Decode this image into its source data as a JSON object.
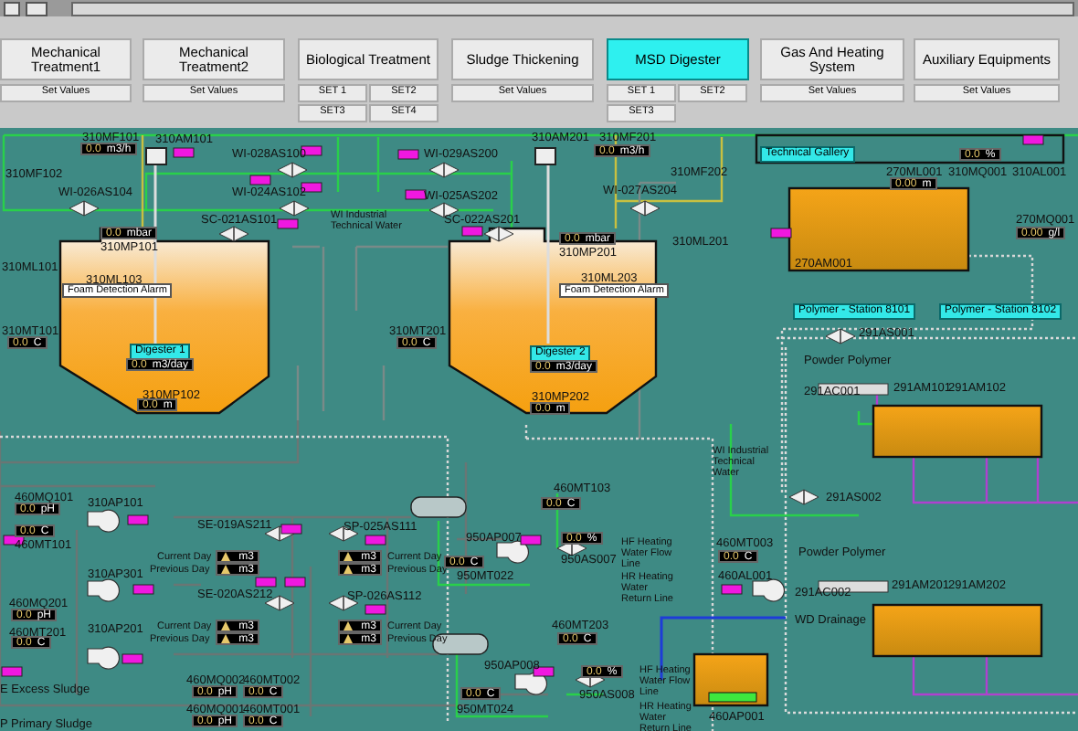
{
  "nav": [
    {
      "label": "Mechanical Treatment1",
      "selected": false,
      "sub": [
        "Set Values"
      ]
    },
    {
      "label": "Mechanical Treatment2",
      "selected": false,
      "sub": [
        "Set Values"
      ]
    },
    {
      "label": "Biological Treatment",
      "selected": false,
      "sub": [
        "SET 1",
        "SET2",
        "SET3",
        "SET4"
      ]
    },
    {
      "label": "Sludge Thickening",
      "selected": false,
      "sub": [
        "Set Values"
      ]
    },
    {
      "label": "MSD Digester",
      "selected": true,
      "sub": [
        "SET 1",
        "SET2",
        "SET3"
      ]
    },
    {
      "label": "Gas And Heating System",
      "selected": false,
      "sub": [
        "Set Values"
      ]
    },
    {
      "label": "Auxiliary Equipments",
      "selected": false,
      "sub": [
        "Set Values"
      ]
    }
  ],
  "diagram": {
    "items": [
      {
        "kind": "tag",
        "text": "310MF101"
      },
      {
        "kind": "readout",
        "value": "0.0",
        "unit": "m3/h"
      },
      {
        "kind": "tag",
        "text": "310AM101"
      },
      {
        "kind": "tag",
        "text": "310MF102"
      },
      {
        "kind": "tag",
        "text": "WI-026AS104"
      },
      {
        "kind": "tag",
        "text": "WI-028AS100"
      },
      {
        "kind": "tag",
        "text": "WI-024AS102"
      },
      {
        "kind": "tag",
        "text": "WI-029AS200"
      },
      {
        "kind": "tag",
        "text": "WI-025AS202"
      },
      {
        "kind": "tag",
        "text": "SC-021AS101"
      },
      {
        "kind": "note",
        "text": "WI Industrial Technical Water"
      },
      {
        "kind": "tag",
        "text": "SC-022AS201"
      },
      {
        "kind": "readout",
        "value": "0.0",
        "unit": "mbar"
      },
      {
        "kind": "tag",
        "text": "310MP101"
      },
      {
        "kind": "tag",
        "text": "310ML101"
      },
      {
        "kind": "tag",
        "text": "310ML103"
      },
      {
        "kind": "alarm",
        "text": "Foam Detection Alarm"
      },
      {
        "kind": "tag",
        "text": "310MT101"
      },
      {
        "kind": "readout",
        "value": "0.0",
        "unit": "C"
      },
      {
        "kind": "label",
        "text": "Digester 1"
      },
      {
        "kind": "readout",
        "value": "0.0",
        "unit": "m3/day"
      },
      {
        "kind": "tag",
        "text": "310MP102"
      },
      {
        "kind": "readout",
        "value": "0.0",
        "unit": "m"
      },
      {
        "kind": "tag",
        "text": "310MT201"
      },
      {
        "kind": "readout",
        "value": "0.0",
        "unit": "C"
      },
      {
        "kind": "tag",
        "text": "310AM201"
      },
      {
        "kind": "tag",
        "text": "310MF201"
      },
      {
        "kind": "readout",
        "value": "0.0",
        "unit": "m3/h"
      },
      {
        "kind": "label",
        "text": "Technical Gallery"
      },
      {
        "kind": "readout",
        "value": "0.0",
        "unit": "%"
      },
      {
        "kind": "tag",
        "text": "310MF202"
      },
      {
        "kind": "tag",
        "text": "270ML001"
      },
      {
        "kind": "tag",
        "text": "310MQ001"
      },
      {
        "kind": "tag",
        "text": "310AL001"
      },
      {
        "kind": "tag",
        "text": "WI-027AS204"
      },
      {
        "kind": "readout",
        "value": "0.00",
        "unit": "m"
      },
      {
        "kind": "readout",
        "value": "0.0",
        "unit": "mbar"
      },
      {
        "kind": "tag",
        "text": "310MP201"
      },
      {
        "kind": "tag",
        "text": "310ML201"
      },
      {
        "kind": "tag",
        "text": "310ML203"
      },
      {
        "kind": "alarm",
        "text": "Foam Detection Alarm"
      },
      {
        "kind": "tag",
        "text": "270AM001"
      },
      {
        "kind": "tag",
        "text": "270MQ001"
      },
      {
        "kind": "readout",
        "value": "0.00",
        "unit": "g/l"
      },
      {
        "kind": "label",
        "text": "Digester 2"
      },
      {
        "kind": "readout",
        "value": "0.0",
        "unit": "m3/day"
      },
      {
        "kind": "tag",
        "text": "310MP202"
      },
      {
        "kind": "readout",
        "value": "0.0",
        "unit": "m"
      },
      {
        "kind": "label",
        "text": "Polymer - Station 8101"
      },
      {
        "kind": "label",
        "text": "Polymer - Station 8102"
      },
      {
        "kind": "tag",
        "text": "291AS001"
      },
      {
        "kind": "tag",
        "text": "Powder Polymer"
      },
      {
        "kind": "tag",
        "text": "291AC001"
      },
      {
        "kind": "tag",
        "text": "291AM101"
      },
      {
        "kind": "tag",
        "text": "291AM102"
      },
      {
        "kind": "tag",
        "text": "460MQ101"
      },
      {
        "kind": "readout",
        "value": "0.0",
        "unit": "pH"
      },
      {
        "kind": "readout",
        "value": "0.0",
        "unit": "C"
      },
      {
        "kind": "tag",
        "text": "460MT101"
      },
      {
        "kind": "tag",
        "text": "310AP101"
      },
      {
        "kind": "tag",
        "text": "310AP301"
      },
      {
        "kind": "tag",
        "text": "310AP201"
      },
      {
        "kind": "tag",
        "text": "460MQ201"
      },
      {
        "kind": "readout",
        "value": "0.0",
        "unit": "pH"
      },
      {
        "kind": "tag",
        "text": "460MT201"
      },
      {
        "kind": "readout",
        "value": "0.0",
        "unit": "C"
      },
      {
        "kind": "tag",
        "text": "SE-019AS211"
      },
      {
        "kind": "note",
        "text": "Current Day"
      },
      {
        "kind": "counter",
        "unit": "m3"
      },
      {
        "kind": "note",
        "text": "Previous Day"
      },
      {
        "kind": "counter",
        "unit": "m3"
      },
      {
        "kind": "tag",
        "text": "SE-020AS212"
      },
      {
        "kind": "note",
        "text": "Current Day"
      },
      {
        "kind": "counter",
        "unit": "m3"
      },
      {
        "kind": "note",
        "text": "Previous Day"
      },
      {
        "kind": "counter",
        "unit": "m3"
      },
      {
        "kind": "tag",
        "text": "SP-025AS111"
      },
      {
        "kind": "counter",
        "unit": "m3"
      },
      {
        "kind": "note",
        "text": "Current Day"
      },
      {
        "kind": "counter",
        "unit": "m3"
      },
      {
        "kind": "note",
        "text": "Previous Day"
      },
      {
        "kind": "tag",
        "text": "SP-026AS112"
      },
      {
        "kind": "counter",
        "unit": "m3"
      },
      {
        "kind": "note",
        "text": "Current Day"
      },
      {
        "kind": "counter",
        "unit": "m3"
      },
      {
        "kind": "note",
        "text": "Previous Day"
      },
      {
        "kind": "tag",
        "text": "950AP007"
      },
      {
        "kind": "readout",
        "value": "0.0",
        "unit": "C"
      },
      {
        "kind": "tag",
        "text": "950MT022"
      },
      {
        "kind": "tag",
        "text": "E Excess Sludge"
      },
      {
        "kind": "tag",
        "text": "P Primary Sludge"
      },
      {
        "kind": "tag",
        "text": "460MQ002"
      },
      {
        "kind": "readout",
        "value": "0.0",
        "unit": "pH"
      },
      {
        "kind": "tag",
        "text": "460MT002"
      },
      {
        "kind": "readout",
        "value": "0.0",
        "unit": "C"
      },
      {
        "kind": "tag",
        "text": "460MQ001"
      },
      {
        "kind": "readout",
        "value": "0.0",
        "unit": "pH"
      },
      {
        "kind": "tag",
        "text": "460MT001"
      },
      {
        "kind": "readout",
        "value": "0.0",
        "unit": "C"
      },
      {
        "kind": "tag",
        "text": "950AP008"
      },
      {
        "kind": "readout",
        "value": "0.0",
        "unit": "C"
      },
      {
        "kind": "tag",
        "text": "950MT024"
      },
      {
        "kind": "note",
        "text": "WI Industrial Technical Water"
      },
      {
        "kind": "tag",
        "text": "460MT103"
      },
      {
        "kind": "readout",
        "value": "0.0",
        "unit": "C"
      },
      {
        "kind": "readout",
        "value": "0.0",
        "unit": "%"
      },
      {
        "kind": "tag",
        "text": "950AS007"
      },
      {
        "kind": "note",
        "text": "HF Heating Water Flow Line"
      },
      {
        "kind": "note",
        "text": "HR Heating Water Return Line"
      },
      {
        "kind": "tag",
        "text": "460MT003"
      },
      {
        "kind": "readout",
        "value": "0.0",
        "unit": "C"
      },
      {
        "kind": "tag",
        "text": "460AL001"
      },
      {
        "kind": "tag",
        "text": "291AS002"
      },
      {
        "kind": "tag",
        "text": "Powder Polymer"
      },
      {
        "kind": "tag",
        "text": "291AC002"
      },
      {
        "kind": "tag",
        "text": "291AM201"
      },
      {
        "kind": "tag",
        "text": "291AM202"
      },
      {
        "kind": "tag",
        "text": "WD Drainage"
      },
      {
        "kind": "tag",
        "text": "460MT203"
      },
      {
        "kind": "readout",
        "value": "0.0",
        "unit": "C"
      },
      {
        "kind": "readout",
        "value": "0.0",
        "unit": "%"
      },
      {
        "kind": "note",
        "text": "HF Heating Water Flow Line"
      },
      {
        "kind": "tag",
        "text": "950AS008"
      },
      {
        "kind": "note",
        "text": "HR Heating Water Return Line"
      },
      {
        "kind": "tag",
        "text": "460AP001"
      }
    ]
  }
}
